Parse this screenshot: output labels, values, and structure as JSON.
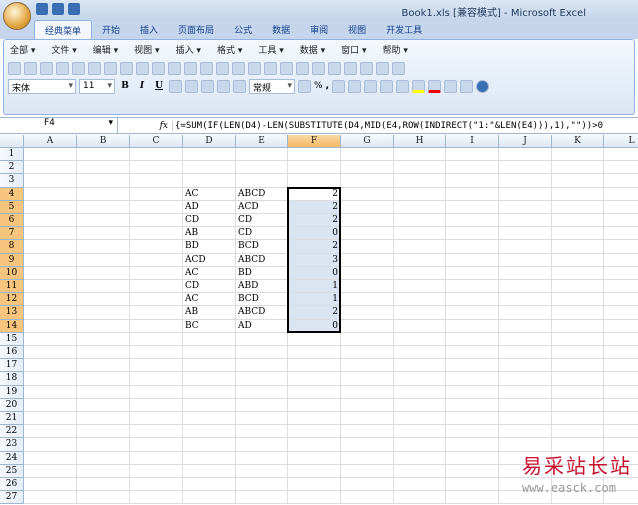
{
  "window": {
    "title": "Book1.xls [兼容模式] - Microsoft Excel"
  },
  "tabs": [
    "经典菜单",
    "开始",
    "插入",
    "页面布局",
    "公式",
    "数据",
    "审阅",
    "视图",
    "开发工具"
  ],
  "menus": [
    "全部 ▾",
    "文件 ▾",
    "编辑 ▾",
    "视图 ▾",
    "插入 ▾",
    "格式 ▾",
    "工具 ▾",
    "数据 ▾",
    "窗口 ▾",
    "帮助 ▾"
  ],
  "toolbar": {
    "font": "宋体",
    "size": "11",
    "bold": "B",
    "italic": "I",
    "underline": "U",
    "number_format": "常规",
    "percent": "%",
    "comma": ","
  },
  "formula_bar": {
    "name_box": "F4",
    "fx": "fx",
    "formula": "{=SUM(IF(LEN(D4)-LEN(SUBSTITUTE(D4,MID(E4,ROW(INDIRECT(\"1:\"&LEN(E4))),1),\"\"))>0"
  },
  "sheet": {
    "columns": [
      "A",
      "B",
      "C",
      "D",
      "E",
      "F",
      "G",
      "H",
      "I",
      "J",
      "K",
      "L"
    ],
    "row_count": 27,
    "active_column": "F",
    "selected_rows": [
      4,
      14
    ],
    "rows": [
      {
        "row": 4,
        "D": "AC",
        "E": "ABCD",
        "F": "2"
      },
      {
        "row": 5,
        "D": "AD",
        "E": "ACD",
        "F": "2"
      },
      {
        "row": 6,
        "D": "CD",
        "E": "CD",
        "F": "2"
      },
      {
        "row": 7,
        "D": "AB",
        "E": "CD",
        "F": "0"
      },
      {
        "row": 8,
        "D": "BD",
        "E": "BCD",
        "F": "2"
      },
      {
        "row": 9,
        "D": "ACD",
        "E": "ABCD",
        "F": "3"
      },
      {
        "row": 10,
        "D": "AC",
        "E": "BD",
        "F": "0"
      },
      {
        "row": 11,
        "D": "CD",
        "E": "ABD",
        "F": "1"
      },
      {
        "row": 12,
        "D": "AC",
        "E": "BCD",
        "F": "1"
      },
      {
        "row": 13,
        "D": "AB",
        "E": "ABCD",
        "F": "2"
      },
      {
        "row": 14,
        "D": "BC",
        "E": "AD",
        "F": "0"
      }
    ]
  },
  "watermark": {
    "text": "易采站长站",
    "url": "www.easck.com"
  }
}
